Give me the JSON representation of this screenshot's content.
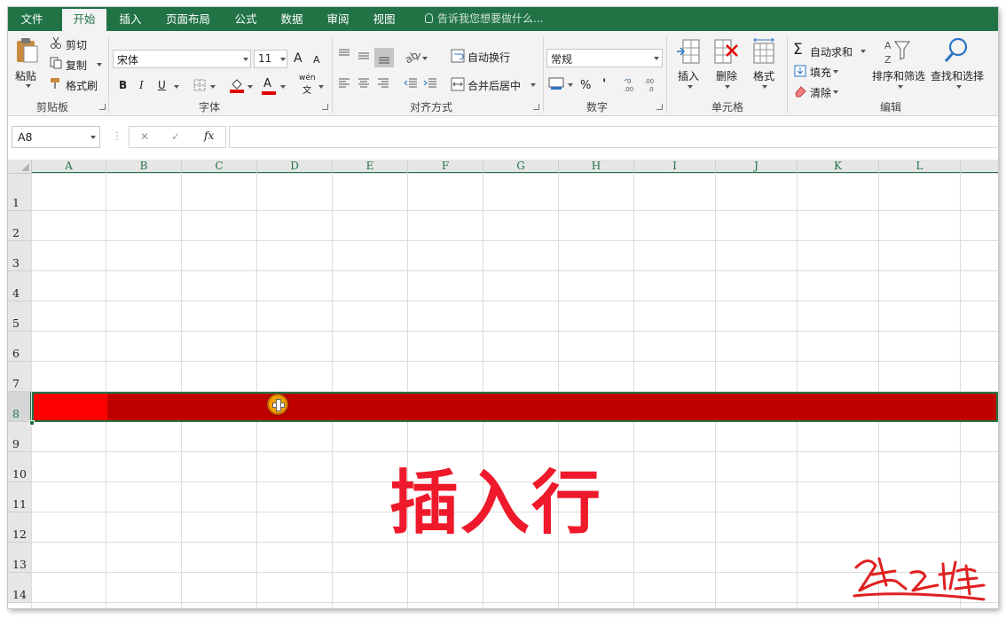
{
  "tabs": [
    "文件",
    "开始",
    "插入",
    "页面布局",
    "公式",
    "数据",
    "审阅",
    "视图"
  ],
  "active_tab": "开始",
  "tell_me": "告诉我您想要做什么...",
  "ribbon": {
    "clipboard": {
      "paste": "粘贴",
      "cut": "剪切",
      "copy": "复制",
      "format_painter": "格式刷",
      "label": "剪贴板"
    },
    "font": {
      "name": "宋体",
      "size": "11",
      "grow": "A",
      "shrink": "A",
      "bold": "B",
      "italic": "I",
      "underline": "U",
      "phonetic_top": "wén",
      "phonetic_bottom": "文",
      "font_color_letter": "A",
      "label": "字体"
    },
    "alignment": {
      "wrap": "自动换行",
      "merge": "合并后居中",
      "label": "对齐方式"
    },
    "number": {
      "format": "常规",
      "percent": "%",
      "comma": "'",
      "label": "数字"
    },
    "cells": {
      "insert": "插入",
      "delete": "删除",
      "format": "格式",
      "label": "单元格"
    },
    "editing": {
      "autosum": "自动求和",
      "fill": "填充",
      "clear": "清除",
      "sort": "排序和筛选",
      "find": "查找和选择",
      "label": "编辑"
    }
  },
  "formula_bar": {
    "name_box": "A8",
    "fx": "fx",
    "cancel": "✕",
    "enter": "✓",
    "formula": ""
  },
  "columns": [
    "A",
    "B",
    "C",
    "D",
    "E",
    "F",
    "G",
    "H",
    "I",
    "J",
    "K",
    "L"
  ],
  "rows": [
    "1",
    "2",
    "3",
    "4",
    "5",
    "6",
    "7",
    "8",
    "9",
    "10",
    "11",
    "12",
    "13",
    "14"
  ],
  "selected_row": "8",
  "overlay_title": "插入行",
  "colors": {
    "excel_green": "#217346",
    "row_fill": "#c00000",
    "active_cell_fill": "#ff0000",
    "title_red": "#ee1a2b"
  }
}
